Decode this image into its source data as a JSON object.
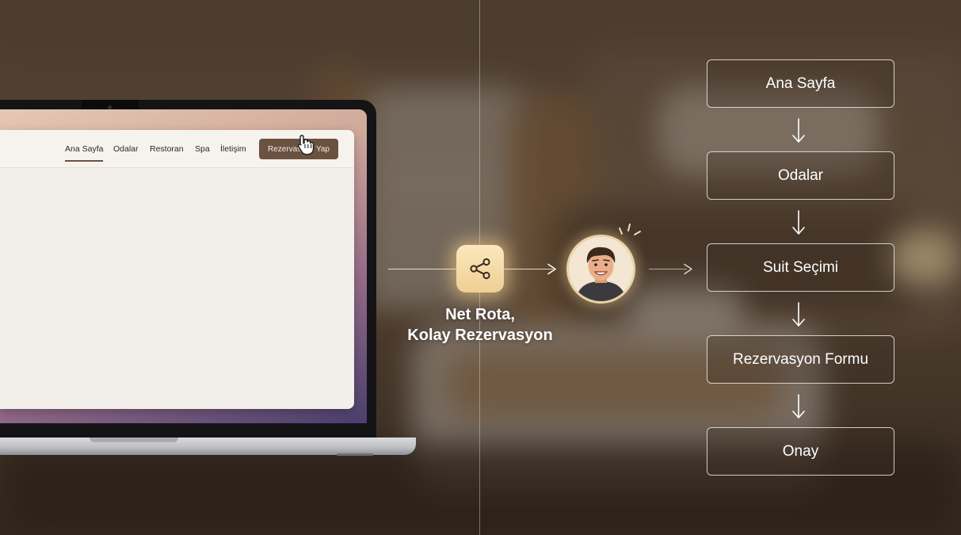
{
  "laptop_site": {
    "nav": [
      "Ana Sayfa",
      "Odalar",
      "Restoran",
      "Spa",
      "İletişim"
    ],
    "cta_label": "Rezervasyon Yap",
    "active_nav": "Ana Sayfa"
  },
  "caption": {
    "line1": "Net Rota,",
    "line2": "Kolay Rezervasyon"
  },
  "icons": {
    "connector": "share-icon",
    "user": "smiling-user-avatar",
    "cursor": "hand-pointer-icon"
  },
  "flow_steps": [
    "Ana Sayfa",
    "Odalar",
    "Suit Seçimi",
    "Rezervasyon Formu",
    "Onay"
  ],
  "colors": {
    "brand_brown": "#6b5240",
    "accent_gold": "#efcf93"
  }
}
